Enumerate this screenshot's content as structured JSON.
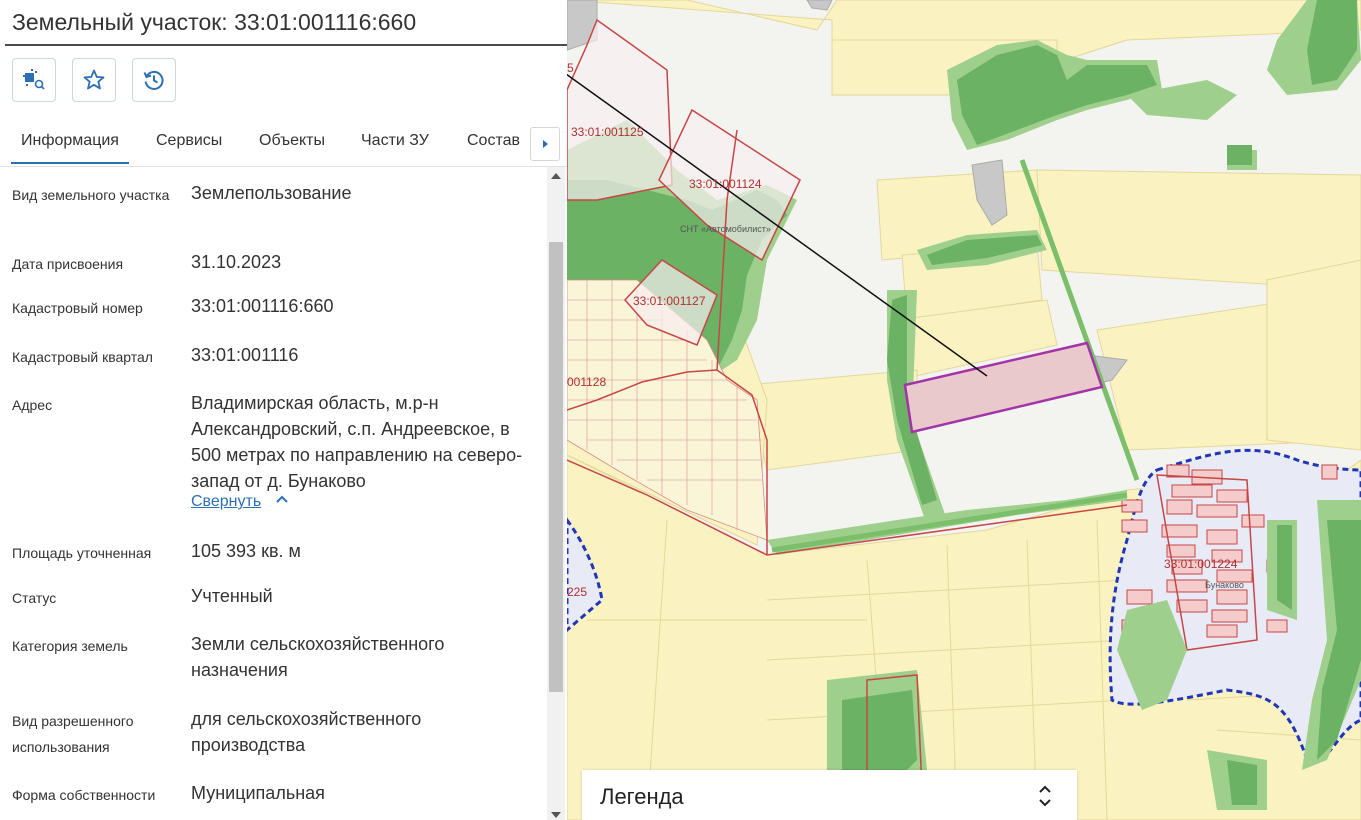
{
  "header": {
    "title": "Земельный участок: 33:01:001116:660"
  },
  "toolbar": {
    "buttons": [
      {
        "icon": "map-search-icon"
      },
      {
        "icon": "star-icon"
      },
      {
        "icon": "history-icon"
      }
    ]
  },
  "tabs": [
    {
      "label": "Информация",
      "active": true
    },
    {
      "label": "Сервисы"
    },
    {
      "label": "Объекты"
    },
    {
      "label": "Части ЗУ"
    },
    {
      "label": "Состав"
    }
  ],
  "info": {
    "rows": [
      {
        "label": "Вид земельного участка",
        "value": "Землепользование"
      },
      {
        "label": "Дата присвоения",
        "value": "31.10.2023"
      },
      {
        "label": "Кадастровый номер",
        "value": "33:01:001116:660"
      },
      {
        "label": "Кадастровый квартал",
        "value": "33:01:001116"
      },
      {
        "label": "Адрес",
        "value": "Владимирская область, м.р-н Александровский, с.п. Андреевское, в 500 метрах по направлению на северо-запад от д. Бунаково"
      },
      {
        "label": "Площадь уточненная",
        "value": "105 393 кв. м"
      },
      {
        "label": "Статус",
        "value": "Учтенный"
      },
      {
        "label": "Категория земель",
        "value": "Земли сельскохозяйственного назначения"
      },
      {
        "label": "Вид разрешенного использования",
        "value": "для сельскохозяйственного производства"
      },
      {
        "label": "Форма собственности",
        "value": "Муниципальная"
      }
    ],
    "collapse_label": "Свернуть"
  },
  "legend": {
    "label": "Легенда"
  },
  "map": {
    "labels": [
      "33:01:001125",
      "33:01:001124",
      "33:01:001127",
      "001128",
      "33:01:001224",
      "225",
      "СНТ «Автомобилист»",
      "Бунаково",
      "5"
    ],
    "colors": {
      "field": "#faf2c0",
      "forest": "#6bb265",
      "forest_light": "#9fcf8d",
      "parcel_border": "#c74646",
      "selected_fill": "#e9c9cc",
      "selected_border": "#a233a8",
      "settlement_boundary": "#2035b8",
      "settlement_fill": "#e8ebf6"
    }
  }
}
